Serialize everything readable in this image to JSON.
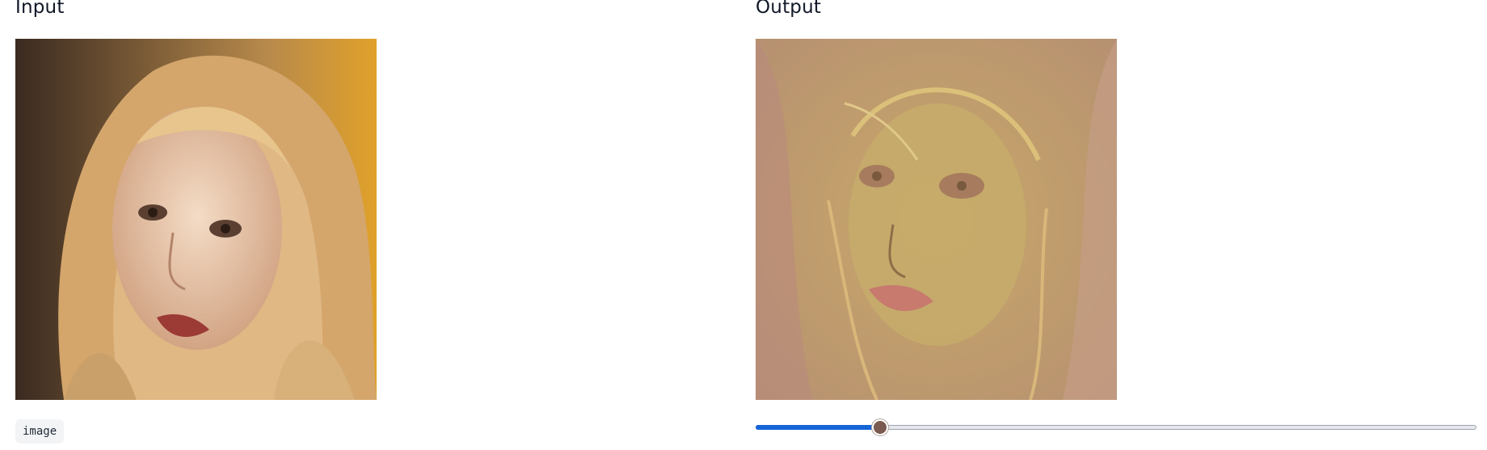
{
  "input_panel": {
    "title": "Input",
    "image_icon": "portrait-photo-icon",
    "badge_label": "image"
  },
  "output_panel": {
    "title": "Output",
    "image_icon": "stylized-portrait-icon"
  },
  "comparison_slider": {
    "value_fraction": 0.173
  },
  "colors": {
    "slider_fill": "#1565d8",
    "slider_thumb": "#7b5a50",
    "badge_background": "#f3f4f6"
  }
}
